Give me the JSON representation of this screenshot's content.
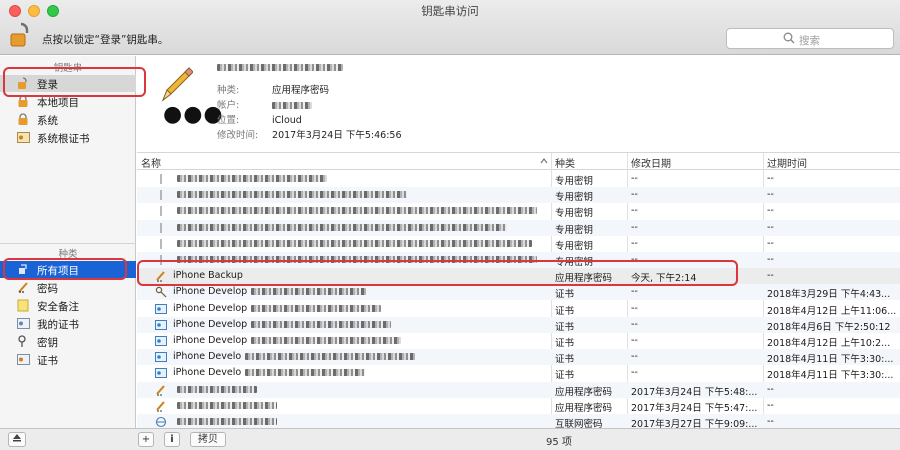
{
  "window": {
    "title": "钥匙串访问"
  },
  "toolbar": {
    "lock_hint": "点按以锁定“登录”钥匙串。",
    "search_placeholder": "搜索"
  },
  "sidebar": {
    "keychains_header": "钥匙串",
    "keychains": [
      {
        "label": "登录",
        "icon": "unlocked-padlock-icon",
        "selected": true
      },
      {
        "label": "本地项目",
        "icon": "padlock-icon"
      },
      {
        "label": "系统",
        "icon": "padlock-icon"
      },
      {
        "label": "系统根证书",
        "icon": "certificate-icon"
      }
    ],
    "categories_header": "种类",
    "categories": [
      {
        "label": "所有项目",
        "icon": "all-items-icon",
        "selected": true
      },
      {
        "label": "密码",
        "icon": "password-pencil-icon"
      },
      {
        "label": "安全备注",
        "icon": "note-icon"
      },
      {
        "label": "我的证书",
        "icon": "my-certificate-icon"
      },
      {
        "label": "密钥",
        "icon": "key-icon"
      },
      {
        "label": "证书",
        "icon": "certificate-icon"
      }
    ]
  },
  "detail": {
    "kind_label": "种类:",
    "kind_value": "应用程序密码",
    "account_label": "帐户:",
    "location_label": "位置:",
    "location_value": "iCloud",
    "modified_label": "修改时间:",
    "modified_value": "2017年3月24日 下午5:46:56"
  },
  "table": {
    "columns": {
      "name": "名称",
      "kind": "种类",
      "modified": "修改日期",
      "expires": "过期时间"
    },
    "rows": [
      {
        "name": "",
        "kind": "专用密钥",
        "modified": "--",
        "expires": "--",
        "icon": "private-key-icon"
      },
      {
        "name": "",
        "kind": "专用密钥",
        "modified": "--",
        "expires": "--",
        "icon": "private-key-icon"
      },
      {
        "name": "",
        "kind": "专用密钥",
        "modified": "--",
        "expires": "--",
        "icon": "private-key-icon"
      },
      {
        "name": "",
        "kind": "专用密钥",
        "modified": "--",
        "expires": "--",
        "icon": "private-key-icon"
      },
      {
        "name": "",
        "kind": "专用密钥",
        "modified": "--",
        "expires": "--",
        "icon": "private-key-icon"
      },
      {
        "name": "",
        "kind": "专用密钥",
        "modified": "--",
        "expires": "--",
        "icon": "private-key-icon"
      },
      {
        "name": "iPhone Backup",
        "kind": "应用程序密码",
        "modified": "今天, 下午2:14",
        "expires": "--",
        "icon": "password-pencil-icon",
        "selected": true
      },
      {
        "name": "iPhone Develop",
        "kind": "证书",
        "modified": "--",
        "expires": "2018年3月29日 下午4:43...",
        "icon": "key-icon"
      },
      {
        "name": "iPhone Develop",
        "kind": "证书",
        "modified": "--",
        "expires": "2018年4月12日 上午11:06...",
        "icon": "certificate-icon"
      },
      {
        "name": "iPhone Develop",
        "kind": "证书",
        "modified": "--",
        "expires": "2018年4月6日 下午2:50:12",
        "icon": "certificate-icon"
      },
      {
        "name": "iPhone Develop",
        "kind": "证书",
        "modified": "--",
        "expires": "2018年4月12日 上午10:2...",
        "icon": "certificate-icon"
      },
      {
        "name": "iPhone Develo",
        "kind": "证书",
        "modified": "--",
        "expires": "2018年4月11日 下午3:30:...",
        "icon": "certificate-icon"
      },
      {
        "name": "iPhone Develo",
        "kind": "证书",
        "modified": "--",
        "expires": "2018年4月11日 下午3:30:...",
        "icon": "certificate-icon"
      },
      {
        "name": "",
        "kind": "应用程序密码",
        "modified": "2017年3月24日 下午5:48:...",
        "expires": "--",
        "icon": "password-pencil-icon"
      },
      {
        "name": "",
        "kind": "应用程序密码",
        "modified": "2017年3月24日 下午5:47:...",
        "expires": "--",
        "icon": "password-pencil-icon"
      },
      {
        "name": "",
        "kind": "互联网密码",
        "modified": "2017年3月27日 下午9:09:...",
        "expires": "--",
        "icon": "internet-password-icon"
      }
    ]
  },
  "bottom": {
    "copy_label": "拷贝",
    "item_count": "95 项"
  },
  "colors": {
    "highlight": "#d9363e",
    "selection_blue": "#1a63d6"
  }
}
